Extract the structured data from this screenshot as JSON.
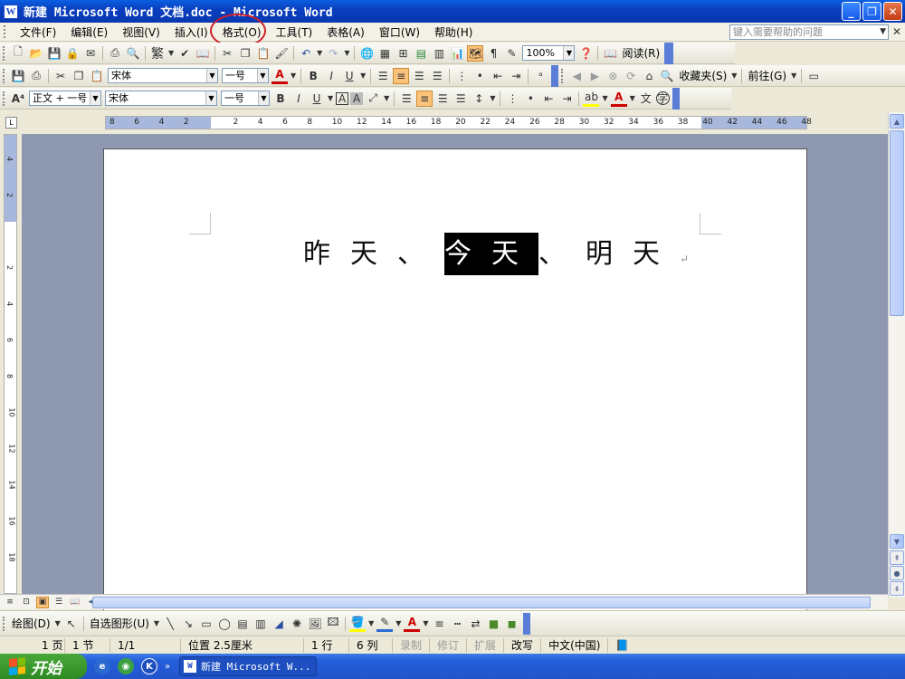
{
  "window": {
    "title": "新建 Microsoft Word 文档.doc - Microsoft Word",
    "app_icon_letter": "W",
    "controls": [
      "_",
      "❐",
      "✕"
    ]
  },
  "menu": {
    "items": [
      "文件(F)",
      "编辑(E)",
      "视图(V)",
      "插入(I)",
      "格式(O)",
      "工具(T)",
      "表格(A)",
      "窗口(W)",
      "帮助(H)"
    ],
    "help_placeholder": "键入需要帮助的问题",
    "highlighted": "格式(O)"
  },
  "standard_toolbar": {
    "zoom": "100%",
    "read_label": "阅读(R)"
  },
  "format_toolbar": {
    "font": "宋体",
    "size": "一号",
    "bold": "B",
    "italic": "I",
    "underline": "U",
    "favorites": "收藏夹(S)",
    "forward": "前往(G)"
  },
  "style_toolbar": {
    "style": "正文 + 一号",
    "font": "宋体",
    "size": "一号"
  },
  "ruler": {
    "numbers": [
      "8",
      "6",
      "4",
      "2",
      "",
      "2",
      "4",
      "6",
      "8",
      "10",
      "12",
      "14",
      "16",
      "18",
      "20",
      "22",
      "24",
      "26",
      "28",
      "30",
      "32",
      "34",
      "36",
      "38",
      "40",
      "42",
      "44",
      "46",
      "48"
    ]
  },
  "vruler": {
    "numbers": [
      "4",
      "2",
      "",
      "2",
      "4",
      "6",
      "8",
      "10",
      "12",
      "14",
      "16",
      "18"
    ]
  },
  "document": {
    "text_before": "昨天、",
    "text_selected": "今天",
    "text_after": "、明天",
    "para_mark": "↵"
  },
  "draw_toolbar": {
    "draw_label": "绘图(D)",
    "autoshape_label": "自选图形(U)"
  },
  "status": {
    "page": "1 页",
    "section": "1 节",
    "pages": "1/1",
    "position": "位置 2.5厘米",
    "line": "1 行",
    "column": "6 列",
    "rec": "录制",
    "trk": "修订",
    "ext": "扩展",
    "ovr": "改写",
    "lang": "中文(中国)"
  },
  "taskbar": {
    "start": "开始",
    "task_item": "新建 Microsoft W..."
  },
  "colors": {
    "title_bar": "#0a4fd4",
    "highlight_circle": "#d0202a",
    "selection": "#000000",
    "active_button": "#fbc37a",
    "start_button": "#2e8a22"
  }
}
